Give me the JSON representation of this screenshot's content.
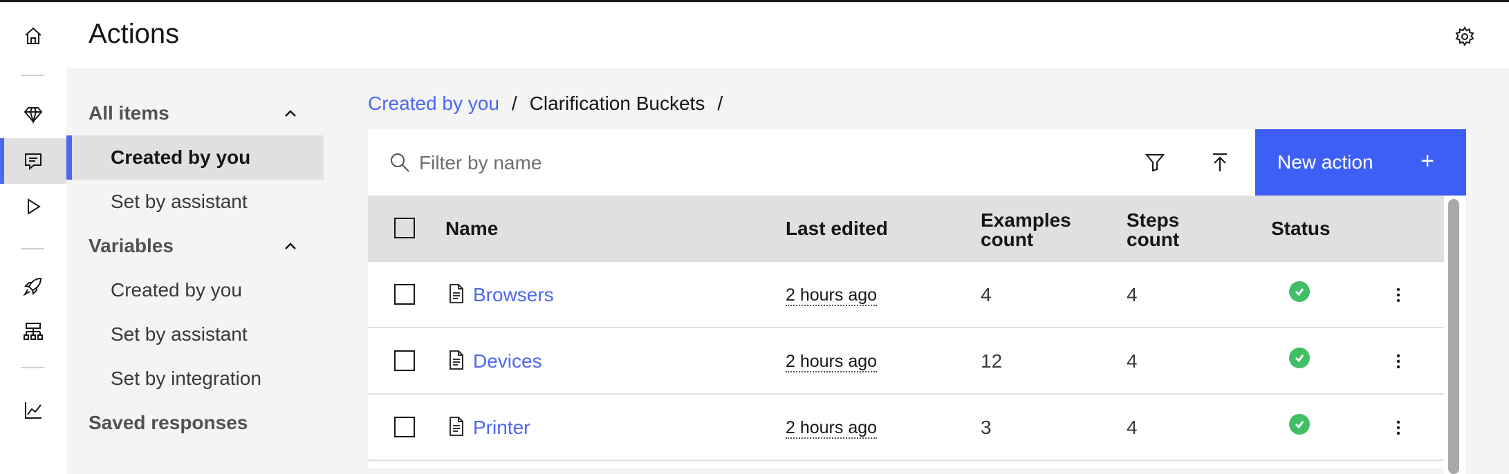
{
  "rail": {
    "icons": [
      "home-icon",
      "diamond-icon",
      "chat-icon",
      "play-icon",
      "rocket-icon",
      "hierarchy-icon",
      "analytics-icon"
    ],
    "active_index": 2,
    "accent_color": "#4c67f2"
  },
  "header": {
    "title": "Actions",
    "settings_icon": "gear-icon"
  },
  "subnav": {
    "groups": [
      {
        "label": "All items",
        "expanded": true,
        "items": [
          {
            "label": "Created by you",
            "active": true
          },
          {
            "label": "Set by assistant",
            "active": false
          }
        ]
      },
      {
        "label": "Variables",
        "expanded": true,
        "items": [
          {
            "label": "Created by you",
            "active": false
          },
          {
            "label": "Set by assistant",
            "active": false
          },
          {
            "label": "Set by integration",
            "active": false
          }
        ]
      },
      {
        "label": "Saved responses",
        "expanded": false,
        "items": []
      }
    ]
  },
  "breadcrumb": {
    "items": [
      "Created by you",
      "Clarification Buckets"
    ],
    "separator": "/"
  },
  "toolbar": {
    "search_placeholder": "Filter by name",
    "search_value": "",
    "filter_icon": "filter-icon",
    "upload_icon": "upload-icon",
    "new_action_label": "New action",
    "new_action_icon": "+",
    "primary_color": "#3e5ff5"
  },
  "table": {
    "columns": [
      "Name",
      "Last edited",
      "Examples count",
      "Steps count",
      "Status"
    ],
    "rows": [
      {
        "name": "Browsers",
        "last_edited": "2 hours ago",
        "examples": "4",
        "steps": "4",
        "status": "complete"
      },
      {
        "name": "Devices",
        "last_edited": "2 hours ago",
        "examples": "12",
        "steps": "4",
        "status": "complete"
      },
      {
        "name": "Printer",
        "last_edited": "2 hours ago",
        "examples": "3",
        "steps": "4",
        "status": "complete"
      }
    ],
    "status_color": "#42be65"
  }
}
